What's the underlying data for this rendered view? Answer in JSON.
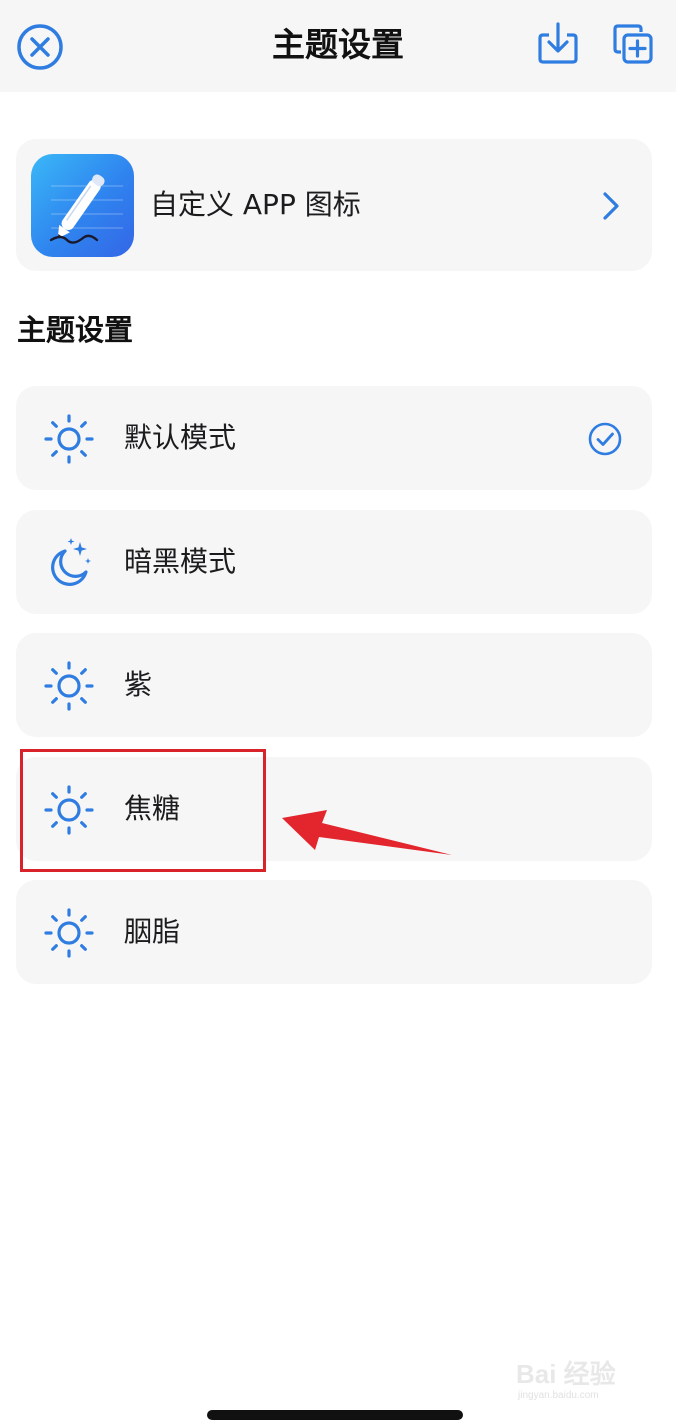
{
  "header": {
    "title": "主题设置",
    "close_icon": "close-circle-icon",
    "download_icon": "tray-download-icon",
    "duplicate_icon": "duplicate-plus-icon"
  },
  "app_icon_card": {
    "label": "自定义 APP 图标",
    "icon": "pen-app-icon",
    "chevron_icon": "chevron-right-icon"
  },
  "section": {
    "title": "主题设置"
  },
  "themes": [
    {
      "label": "默认模式",
      "icon": "sun-icon",
      "selected": true
    },
    {
      "label": "暗黑模式",
      "icon": "moon-stars-icon",
      "selected": false
    },
    {
      "label": "紫",
      "icon": "sun-icon",
      "selected": false
    },
    {
      "label": "焦糖",
      "icon": "sun-icon",
      "selected": false
    },
    {
      "label": "胭脂",
      "icon": "sun-icon",
      "selected": false
    }
  ],
  "annotation": {
    "highlighted_theme": "焦糖",
    "highlight_color": "#d9232b"
  },
  "watermark": {
    "brand": "Bai 经验",
    "url": "jingyan.baidu.com"
  },
  "colors": {
    "accent": "#2f7de1",
    "card_background": "#f6f6f6",
    "nav_background": "#f6f6f6",
    "annotation_red": "#d9232b"
  }
}
